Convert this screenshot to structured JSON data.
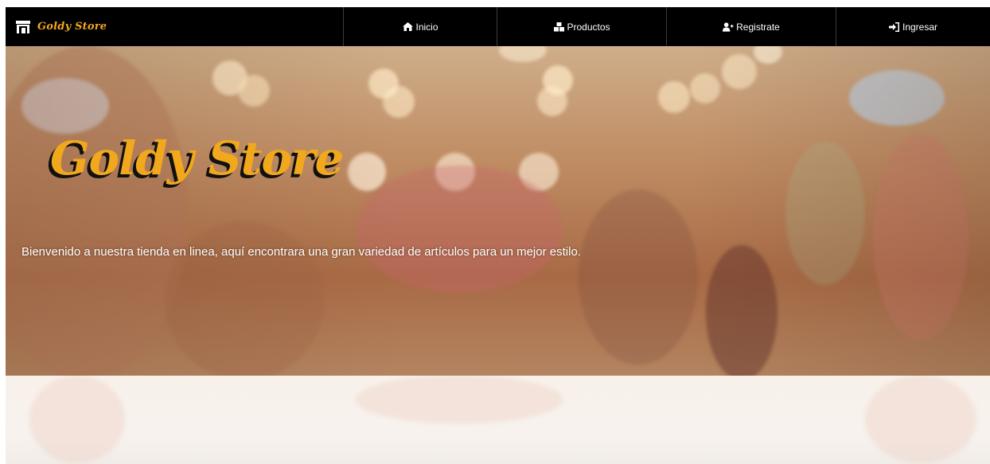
{
  "brand": {
    "name": "Goldy Store",
    "icon": "store-icon"
  },
  "nav": {
    "items": [
      {
        "label": "Inicio",
        "icon": "home-icon"
      },
      {
        "label": "Productos",
        "icon": "cubes-icon"
      },
      {
        "label": "Registrate",
        "icon": "user-plus-icon"
      },
      {
        "label": "Ingresar",
        "icon": "sign-in-icon"
      }
    ]
  },
  "hero": {
    "title": "Goldy Store",
    "subtitle": "Bienvenido a nuestra tienda en linea, aquí encontrara una gran variedad de artículos para un mejor estilo."
  },
  "colors": {
    "navbar_bg": "#000000",
    "brand_accent": "#f2a81c",
    "nav_text": "#ffffff",
    "hero_text": "#ffffff"
  }
}
